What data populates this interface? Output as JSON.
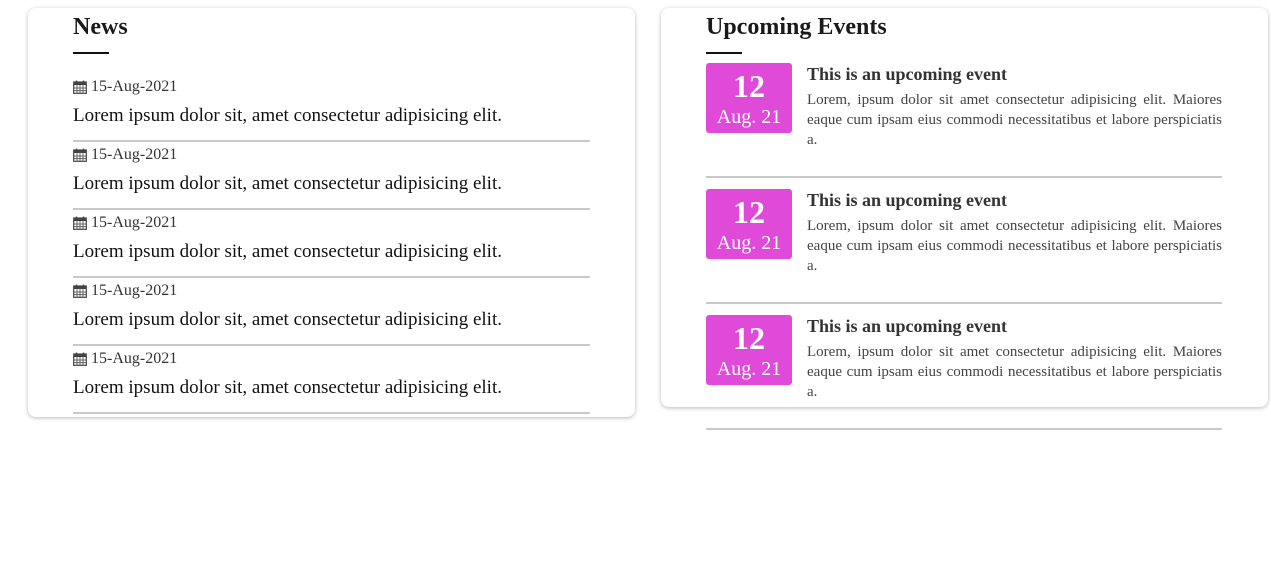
{
  "news": {
    "heading": "News",
    "items": [
      {
        "date": "15-Aug-2021",
        "text": "Lorem ipsum dolor sit, amet consectetur adipisicing elit."
      },
      {
        "date": "15-Aug-2021",
        "text": "Lorem ipsum dolor sit, amet consectetur adipisicing elit."
      },
      {
        "date": "15-Aug-2021",
        "text": "Lorem ipsum dolor sit, amet consectetur adipisicing elit."
      },
      {
        "date": "15-Aug-2021",
        "text": "Lorem ipsum dolor sit, amet consectetur adipisicing elit."
      },
      {
        "date": "15-Aug-2021",
        "text": "Lorem ipsum dolor sit, amet consectetur adipisicing elit."
      }
    ],
    "icon": "calendar-icon"
  },
  "events": {
    "heading": "Upcoming Events",
    "badge_color": "#e04ad8",
    "items": [
      {
        "day": "12",
        "month": "Aug. 21",
        "title": "This is an upcoming event",
        "desc": "Lorem, ipsum dolor sit amet consectetur adipisicing elit. Maiores eaque cum ipsam eius commodi necessitatibus et labore perspiciatis a."
      },
      {
        "day": "12",
        "month": "Aug. 21",
        "title": "This is an upcoming event",
        "desc": "Lorem, ipsum dolor sit amet consectetur adipisicing elit. Maiores eaque cum ipsam eius commodi necessitatibus et labore perspiciatis a."
      },
      {
        "day": "12",
        "month": "Aug. 21",
        "title": "This is an upcoming event",
        "desc": "Lorem, ipsum dolor sit amet consectetur adipisicing elit. Maiores eaque cum ipsam eius commodi necessitatibus et labore perspiciatis a."
      }
    ]
  }
}
